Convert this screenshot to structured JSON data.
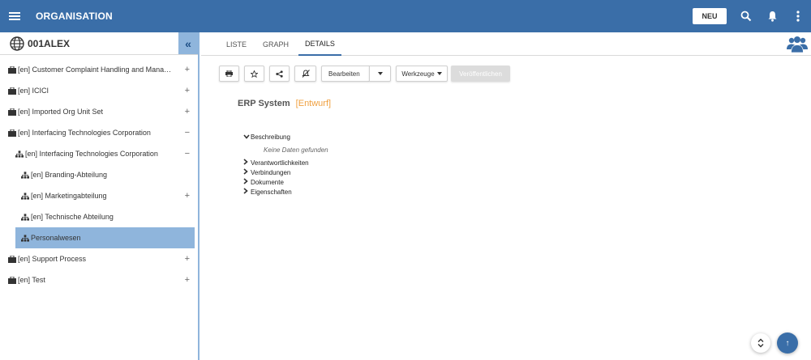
{
  "header": {
    "title": "ORGANISATION",
    "new_label": "NEU",
    "color": "#3a6ea8",
    "icons": [
      "menu-icon",
      "search-icon",
      "bell-icon",
      "more-vert-icon"
    ]
  },
  "sidebar": {
    "root": "001ALEX",
    "collapse_glyph": "«",
    "items": [
      {
        "label": "[en] Customer Complaint Handling and Manag...",
        "toggle": "+",
        "icon": "briefcase-icon"
      },
      {
        "label": "[en] ICICI",
        "toggle": "+",
        "icon": "briefcase-icon"
      },
      {
        "label": "[en] Imported Org Unit Set",
        "toggle": "+",
        "icon": "briefcase-icon"
      },
      {
        "label": "[en] Interfacing Technologies Corporation",
        "toggle": "−",
        "icon": "briefcase-icon"
      },
      {
        "label": "[en] Interfacing Technologies Corporation",
        "toggle": "−",
        "icon": "org-unit-icon"
      },
      {
        "label": "[en] Branding-Abteilung",
        "toggle": "",
        "icon": "org-unit-icon"
      },
      {
        "label": "[en] Marketingabteilung",
        "toggle": "+",
        "icon": "org-unit-icon"
      },
      {
        "label": "[en] Technische Abteilung",
        "toggle": "",
        "icon": "org-unit-icon"
      },
      {
        "label": "Personalwesen",
        "toggle": "",
        "icon": "org-unit-icon"
      },
      {
        "label": "[en] Support Process",
        "toggle": "+",
        "icon": "briefcase-icon"
      },
      {
        "label": "[en] Test",
        "toggle": "+",
        "icon": "briefcase-icon"
      }
    ]
  },
  "tabs": [
    "LISTE",
    "GRAPH",
    "DETAILS"
  ],
  "toolbar": {
    "edit": "Bearbeiten",
    "tools": "Werkzeuge",
    "publish": "Veröffentlichen"
  },
  "document": {
    "title": "ERP System",
    "status": "[Entwurf]",
    "sections": [
      "Beschreibung",
      "Verantwortlichkeiten",
      "Verbindungen",
      "Dokumente",
      "Eigenschaften"
    ],
    "empty_text": "Keine Daten gefunden"
  },
  "fab": {
    "scroll_glyph": "⌃⌄",
    "up_glyph": "↑"
  }
}
